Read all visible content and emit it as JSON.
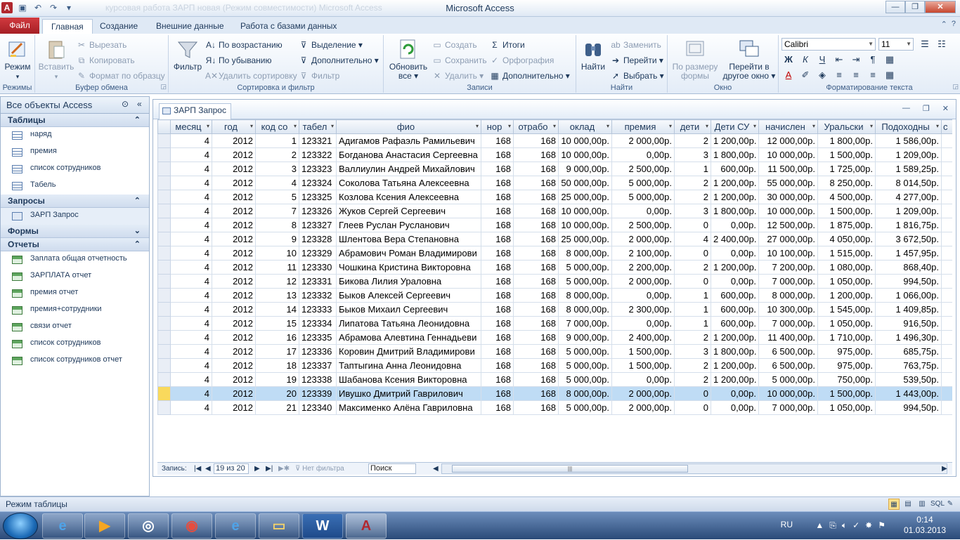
{
  "window": {
    "title": "Microsoft Access",
    "doc_title": "курсовая работа ЗАРП новая (Режим совместимости) Microsoft Access"
  },
  "ribbon_tabs": [
    "Файл",
    "Главная",
    "Создание",
    "Внешние данные",
    "Работа с базами данных"
  ],
  "ribbon": {
    "rejimy": {
      "label": "Режимы",
      "btn": "Режим"
    },
    "bufer": {
      "label": "Буфер обмена",
      "paste": "Вставить",
      "cut": "Вырезать",
      "copy": "Копировать",
      "format": "Формат по образцу"
    },
    "sort": {
      "label": "Сортировка и фильтр",
      "filter": "Фильтр",
      "asc": "По возрастанию",
      "desc": "По убыванию",
      "remove": "Удалить сортировку",
      "selection": "Выделение",
      "advanced": "Дополнительно",
      "toggle": "Фильтр"
    },
    "zapisi": {
      "label": "Записи",
      "refresh_1": "Обновить",
      "refresh_2": "все",
      "create": "Создать",
      "save": "Сохранить",
      "delete": "Удалить",
      "totals": "Итоги",
      "spelling": "Орфография",
      "more": "Дополнительно"
    },
    "naiti": {
      "label": "Найти",
      "find": "Найти",
      "replace": "Заменить",
      "goto": "Перейти",
      "select": "Выбрать"
    },
    "okno": {
      "label": "Окно",
      "fit_1": "По размеру",
      "fit_2": "формы",
      "switch_1": "Перейти в",
      "switch_2": "другое окно"
    },
    "text": {
      "label": "Форматирование текста",
      "font": "Calibri",
      "size": "11"
    }
  },
  "nav": {
    "title": "Все объекты Access",
    "sections": [
      {
        "title": "Таблицы",
        "items": [
          "наряд",
          "премия",
          "список сотрудников",
          "Табель"
        ]
      },
      {
        "title": "Запросы",
        "items": [
          "ЗАРП Запрос"
        ]
      },
      {
        "title": "Формы",
        "items": []
      },
      {
        "title": "Отчеты",
        "items": [
          "Заплата общая отчетность",
          "ЗАРПЛАТА отчет",
          "премия отчет",
          "премия+сотрудники",
          "связи отчет",
          "список сотрудников",
          "список сотрудников отчет"
        ]
      }
    ]
  },
  "document": {
    "tab": "ЗАРП Запрос",
    "columns": [
      "месяц",
      "год",
      "код со",
      "табел",
      "фио",
      "нор",
      "отрабо",
      "оклад",
      "премия",
      "дети",
      "Дети СУ",
      "начислен",
      "Уральски",
      "Подоходны",
      "с"
    ],
    "rows": [
      [
        "4",
        "2012",
        "1",
        "123321",
        "Адигамов Рафаэль Рамильевич",
        "168",
        "168",
        "10 000,00р.",
        "2 000,00р.",
        "2",
        "1 200,00р.",
        "12 000,00р.",
        "1 800,00р.",
        "1 586,00р."
      ],
      [
        "4",
        "2012",
        "2",
        "123322",
        "Богданова Анастасия Сергеевна",
        "168",
        "168",
        "10 000,00р.",
        "0,00р.",
        "3",
        "1 800,00р.",
        "10 000,00р.",
        "1 500,00р.",
        "1 209,00р."
      ],
      [
        "4",
        "2012",
        "3",
        "123323",
        "Валлиулин Андрей Михайлович",
        "168",
        "168",
        "9 000,00р.",
        "2 500,00р.",
        "1",
        "600,00р.",
        "11 500,00р.",
        "1 725,00р.",
        "1 589,25р."
      ],
      [
        "4",
        "2012",
        "4",
        "123324",
        "Соколова Татьяна Алексеевна",
        "168",
        "168",
        "50 000,00р.",
        "5 000,00р.",
        "2",
        "1 200,00р.",
        "55 000,00р.",
        "8 250,00р.",
        "8 014,50р."
      ],
      [
        "4",
        "2012",
        "5",
        "123325",
        "Козлова Ксения Алексеевна",
        "168",
        "168",
        "25 000,00р.",
        "5 000,00р.",
        "2",
        "1 200,00р.",
        "30 000,00р.",
        "4 500,00р.",
        "4 277,00р."
      ],
      [
        "4",
        "2012",
        "7",
        "123326",
        "Жуков Сергей Сергеевич",
        "168",
        "168",
        "10 000,00р.",
        "0,00р.",
        "3",
        "1 800,00р.",
        "10 000,00р.",
        "1 500,00р.",
        "1 209,00р."
      ],
      [
        "4",
        "2012",
        "8",
        "123327",
        "Глеев Руслан Русланович",
        "168",
        "168",
        "10 000,00р.",
        "2 500,00р.",
        "0",
        "0,00р.",
        "12 500,00р.",
        "1 875,00р.",
        "1 816,75р."
      ],
      [
        "4",
        "2012",
        "9",
        "123328",
        "Шлентова Вера Степановна",
        "168",
        "168",
        "25 000,00р.",
        "2 000,00р.",
        "4",
        "2 400,00р.",
        "27 000,00р.",
        "4 050,00р.",
        "3 672,50р."
      ],
      [
        "4",
        "2012",
        "10",
        "123329",
        "Абрамович Роман Владимирови",
        "168",
        "168",
        "8 000,00р.",
        "2 100,00р.",
        "0",
        "0,00р.",
        "10 100,00р.",
        "1 515,00р.",
        "1 457,95р."
      ],
      [
        "4",
        "2012",
        "11",
        "123330",
        "Чошкина Кристина Викторовна",
        "168",
        "168",
        "5 000,00р.",
        "2 200,00р.",
        "2",
        "1 200,00р.",
        "7 200,00р.",
        "1 080,00р.",
        "868,40р."
      ],
      [
        "4",
        "2012",
        "12",
        "123331",
        "Бикова Лилия Ураловна",
        "168",
        "168",
        "5 000,00р.",
        "2 000,00р.",
        "0",
        "0,00р.",
        "7 000,00р.",
        "1 050,00р.",
        "994,50р."
      ],
      [
        "4",
        "2012",
        "13",
        "123332",
        "Быков Алексей Сергеевич",
        "168",
        "168",
        "8 000,00р.",
        "0,00р.",
        "1",
        "600,00р.",
        "8 000,00р.",
        "1 200,00р.",
        "1 066,00р."
      ],
      [
        "4",
        "2012",
        "14",
        "123333",
        "Быков Михаил Сергеевич",
        "168",
        "168",
        "8 000,00р.",
        "2 300,00р.",
        "1",
        "600,00р.",
        "10 300,00р.",
        "1 545,00р.",
        "1 409,85р."
      ],
      [
        "4",
        "2012",
        "15",
        "123334",
        "Липатова Татьяна Леонидовна",
        "168",
        "168",
        "7 000,00р.",
        "0,00р.",
        "1",
        "600,00р.",
        "7 000,00р.",
        "1 050,00р.",
        "916,50р."
      ],
      [
        "4",
        "2012",
        "16",
        "123335",
        "Абрамова Алевтина Геннадьеви",
        "168",
        "168",
        "9 000,00р.",
        "2 400,00р.",
        "2",
        "1 200,00р.",
        "11 400,00р.",
        "1 710,00р.",
        "1 496,30р."
      ],
      [
        "4",
        "2012",
        "17",
        "123336",
        "Коровин Дмитрий Владимирови",
        "168",
        "168",
        "5 000,00р.",
        "1 500,00р.",
        "3",
        "1 800,00р.",
        "6 500,00р.",
        "975,00р.",
        "685,75р."
      ],
      [
        "4",
        "2012",
        "18",
        "123337",
        "Таптыгина Анна Леонидовна",
        "168",
        "168",
        "5 000,00р.",
        "1 500,00р.",
        "2",
        "1 200,00р.",
        "6 500,00р.",
        "975,00р.",
        "763,75р."
      ],
      [
        "4",
        "2012",
        "19",
        "123338",
        "Шабанова Ксения Викторовна",
        "168",
        "168",
        "5 000,00р.",
        "0,00р.",
        "2",
        "1 200,00р.",
        "5 000,00р.",
        "750,00р.",
        "539,50р."
      ],
      [
        "4",
        "2012",
        "20",
        "123339",
        "Ивушко Дмитрий Гаврилович",
        "168",
        "168",
        "8 000,00р.",
        "2 000,00р.",
        "0",
        "0,00р.",
        "10 000,00р.",
        "1 500,00р.",
        "1 443,00р."
      ],
      [
        "4",
        "2012",
        "21",
        "123340",
        "Максименко Алёна Гавриловна",
        "168",
        "168",
        "5 000,00р.",
        "2 000,00р.",
        "0",
        "0,00р.",
        "7 000,00р.",
        "1 050,00р.",
        "994,50р."
      ]
    ],
    "current_row": 18,
    "navbar": {
      "record_label": "Запись:",
      "record_pos": "19 из 20",
      "no_filter": "Нет фильтра",
      "search": "Поиск"
    }
  },
  "status": {
    "text": "Режим таблицы"
  },
  "tray": {
    "lang": "RU",
    "time": "0:14",
    "date": "01.03.2013"
  }
}
